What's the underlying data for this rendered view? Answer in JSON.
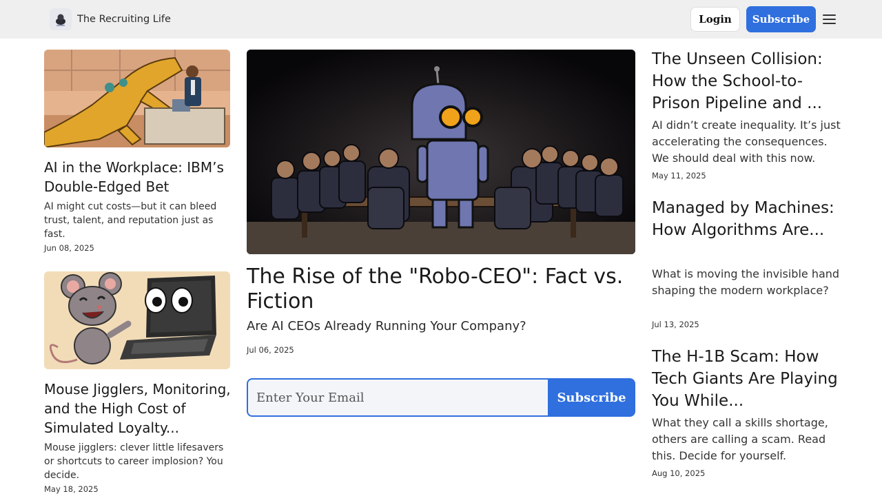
{
  "header": {
    "brand_name": "The Recruiting Life",
    "login_label": "Login",
    "subscribe_label": "Subscribe"
  },
  "left_articles": [
    {
      "title": "AI in the Workplace: IBM’s Double-Edged Bet",
      "description": "AI might cut costs—but it can bleed trust, talent, and reputation just as fast.",
      "date": "Jun 08, 2025"
    },
    {
      "title": "Mouse Jigglers, Monitoring, and the High Cost of Simulated Loyalty...",
      "description": "Mouse jigglers: clever little lifesavers or shortcuts to career implosion? You decide.",
      "date": "May 18, 2025"
    }
  ],
  "featured": {
    "title": "The Rise of the \"Robo-CEO\": Fact vs. Fiction",
    "subtitle": "Are AI CEOs Already Running Your Company?",
    "date": "Jul 06, 2025"
  },
  "newsletter": {
    "placeholder": "Enter Your Email",
    "button_label": "Subscribe"
  },
  "right_articles": [
    {
      "title": "The Unseen Collision: How the School-to-Prison Pipeline and ...",
      "description": "AI didn’t create inequality. It’s just accelerating the consequences. We should deal with this now.",
      "date": "May 11, 2025"
    },
    {
      "title": "Managed by Machines: How Algorithms Are...",
      "description": "What is moving the invisible hand shaping the modern workplace?",
      "date": "Jul 13, 2025"
    },
    {
      "title": "The H-1B Scam: How Tech Giants Are Playing You While...",
      "description": "What they call a skills shortage, others are calling a scam. Read this. Decide for yourself.",
      "date": "Aug 10, 2025"
    }
  ],
  "colors": {
    "accent": "#2f6fde",
    "header_bg": "#efefef"
  }
}
